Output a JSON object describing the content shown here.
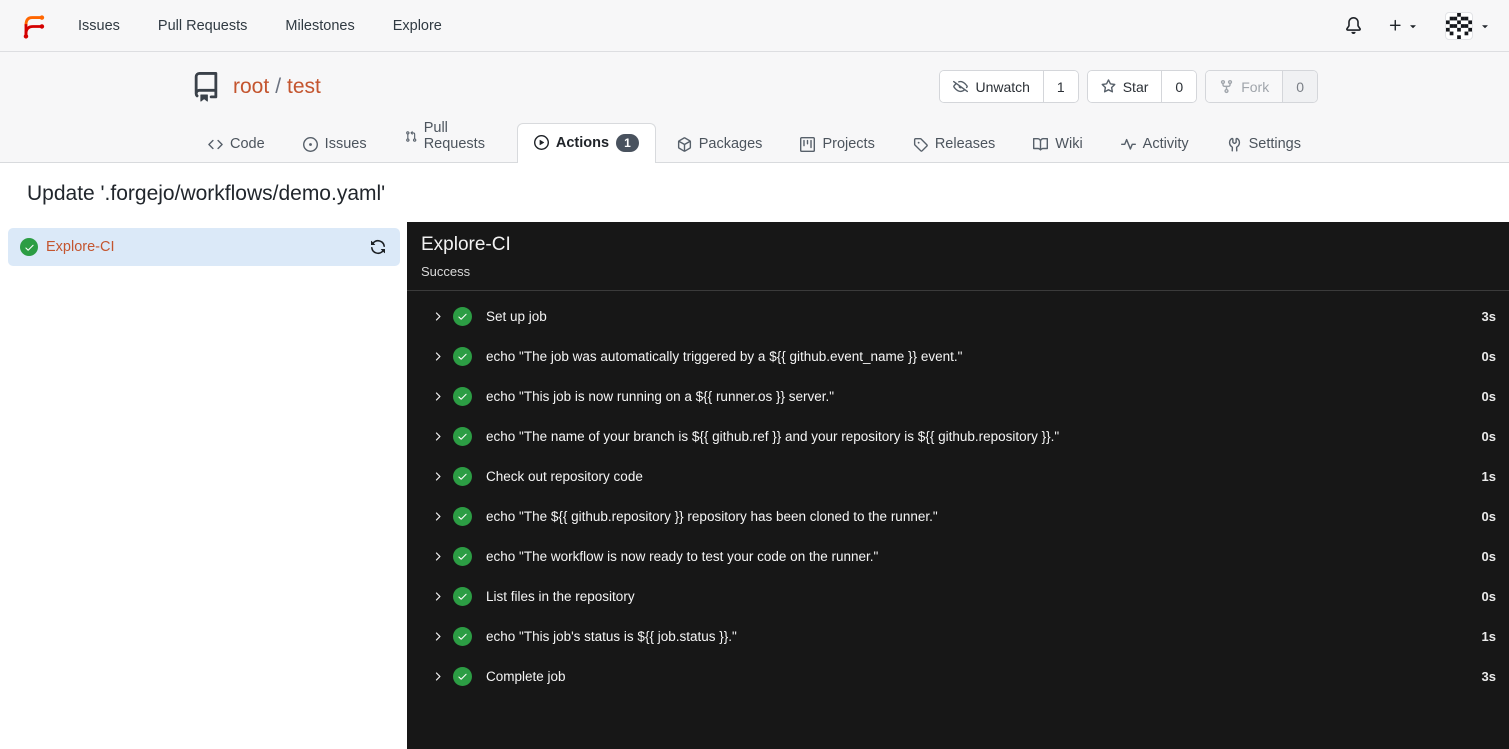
{
  "colors": {
    "accent_link": "#c4552f",
    "success_green": "#2c9d44",
    "selected_job_bg": "#dbe9f8",
    "panel_bg": "#171717",
    "tab_badge_bg": "#49525e"
  },
  "navbar": {
    "links": [
      {
        "label": "Issues"
      },
      {
        "label": "Pull Requests"
      },
      {
        "label": "Milestones"
      },
      {
        "label": "Explore"
      }
    ],
    "icons": [
      "forgejo-logo",
      "bell-icon",
      "plus-icon",
      "caret-down-icon",
      "avatar-identicon",
      "caret-down-icon"
    ]
  },
  "repo_header": {
    "owner": "root",
    "separator": "/",
    "name": "test",
    "actions": [
      {
        "label": "Unwatch",
        "count": "1",
        "icon": "eye-slash-icon"
      },
      {
        "label": "Star",
        "count": "0",
        "icon": "star-icon"
      },
      {
        "label": "Fork",
        "count": "0",
        "icon": "fork-icon",
        "disabled": true
      }
    ]
  },
  "tabs": [
    {
      "label": "Code",
      "icon": "code-icon"
    },
    {
      "label": "Issues",
      "icon": "issue-icon"
    },
    {
      "label": "Pull Requests",
      "icon": "pull-request-icon"
    },
    {
      "label": "Actions",
      "icon": "play-circle-icon",
      "badge": "1",
      "active": true
    },
    {
      "label": "Packages",
      "icon": "package-icon"
    },
    {
      "label": "Projects",
      "icon": "project-icon"
    },
    {
      "label": "Releases",
      "icon": "tag-icon"
    },
    {
      "label": "Wiki",
      "icon": "book-icon"
    },
    {
      "label": "Activity",
      "icon": "pulse-icon"
    },
    {
      "label": "Settings",
      "icon": "tools-icon"
    }
  ],
  "run": {
    "title": "Update '.forgejo/workflows/demo.yaml'",
    "sidebar_job": {
      "name": "Explore-CI",
      "status": "success"
    },
    "panel": {
      "title": "Explore-CI",
      "status": "Success"
    },
    "steps": [
      {
        "name": "Set up job",
        "duration": "3s"
      },
      {
        "name": "echo \"The job was automatically triggered by a ${{ github.event_name }} event.\"",
        "duration": "0s"
      },
      {
        "name": "echo \"This job is now running on a ${{ runner.os }} server.\"",
        "duration": "0s"
      },
      {
        "name": "echo \"The name of your branch is ${{ github.ref }} and your repository is ${{ github.repository }}.\"",
        "duration": "0s"
      },
      {
        "name": "Check out repository code",
        "duration": "1s"
      },
      {
        "name": "echo \"The ${{ github.repository }} repository has been cloned to the runner.\"",
        "duration": "0s"
      },
      {
        "name": "echo \"The workflow is now ready to test your code on the runner.\"",
        "duration": "0s"
      },
      {
        "name": "List files in the repository",
        "duration": "0s"
      },
      {
        "name": "echo \"This job's status is ${{ job.status }}.\"",
        "duration": "1s"
      },
      {
        "name": "Complete job",
        "duration": "3s"
      }
    ]
  }
}
